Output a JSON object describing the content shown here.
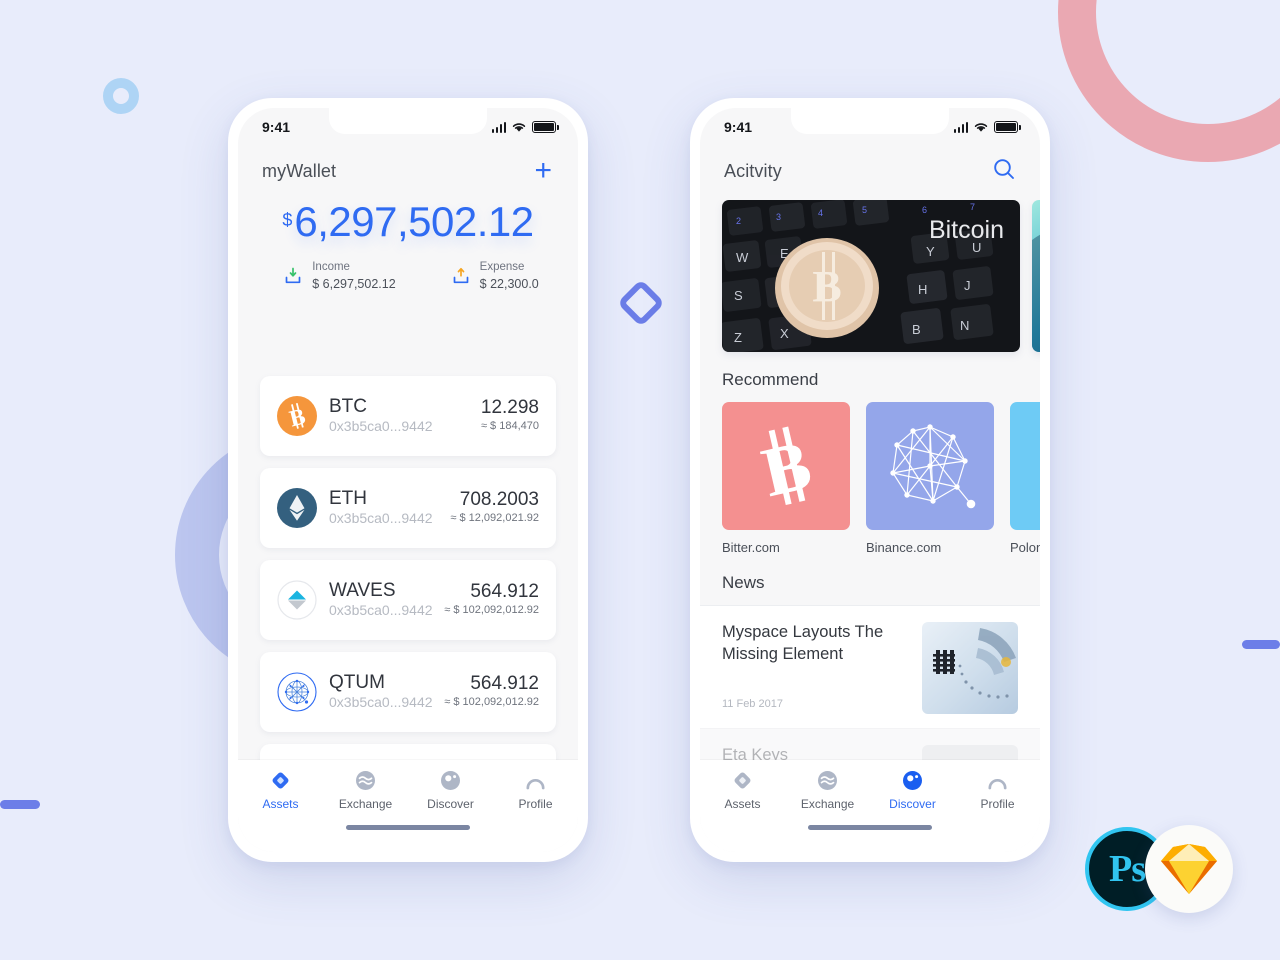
{
  "canvas": {
    "background_color": "#e8ecfb"
  },
  "decorations": {
    "ring_pink_color": "#eaa8b2",
    "ring_blue_small_color": "#aed4f5",
    "ring_periwinkle_color": "#bcc6ef",
    "bar_color": "#6c7ee8",
    "diamond_color": "#6c7ee8"
  },
  "status_bar": {
    "time": "9:41",
    "signal_icon": "cellular-signal-icon",
    "wifi_icon": "wifi-icon",
    "battery_icon": "battery-icon"
  },
  "wallet_screen": {
    "nav": {
      "title": "myWallet",
      "add_label": "+",
      "add_icon": "plus-icon"
    },
    "balance": {
      "currency_symbol": "$",
      "amount": "6,297,502.12",
      "accent_color": "#2f6bf2"
    },
    "summary": [
      {
        "icon": "income-download-icon",
        "label": "Income",
        "value": "$ 6,297,502.12",
        "arrow_color": "#37c16a"
      },
      {
        "icon": "expense-upload-icon",
        "label": "Expense",
        "value": "$ 22,300.0",
        "arrow_color": "#f5a623"
      }
    ],
    "assets": [
      {
        "icon": "bitcoin-icon",
        "symbol": "BTC",
        "address": "0x3b5ca0...9442",
        "quantity": "12.298",
        "usd": "≈ $ 184,470"
      },
      {
        "icon": "ethereum-icon",
        "symbol": "ETH",
        "address": "0x3b5ca0...9442",
        "quantity": "708.2003",
        "usd": "≈ $ 12,092,021.92"
      },
      {
        "icon": "waves-icon",
        "symbol": "WAVES",
        "address": "0x3b5ca0...9442",
        "quantity": "564.912",
        "usd": "≈ $ 102,092,012.92"
      },
      {
        "icon": "qtum-icon",
        "symbol": "QTUM",
        "address": "0x3b5ca0...9442",
        "quantity": "564.912",
        "usd": "≈ $ 102,092,012.92"
      }
    ],
    "tabs": [
      {
        "label": "Assets",
        "icon": "assets-diamond-icon",
        "active": true
      },
      {
        "label": "Exchange",
        "icon": "exchange-waves-icon",
        "active": false
      },
      {
        "label": "Discover",
        "icon": "discover-compass-icon",
        "active": false
      },
      {
        "label": "Profile",
        "icon": "profile-person-icon",
        "active": false
      }
    ]
  },
  "discover_screen": {
    "nav": {
      "title": "Acitvity",
      "search_icon": "search-icon"
    },
    "carousel": [
      {
        "label": "Bitcoin",
        "image": "bitcoin-coin-on-keyboard-photo"
      },
      {
        "label": "",
        "image": "teal-abstract-photo"
      }
    ],
    "recommend": {
      "title": "Recommend",
      "items": [
        {
          "name": "Bitter.com",
          "icon": "bitcoin-b-icon",
          "color": "#f49090"
        },
        {
          "name": "Binance.com",
          "icon": "polygon-mesh-icon",
          "color": "#94a6ea"
        },
        {
          "name": "Poloniex",
          "icon": "poloniex-icon",
          "color": "#6ecbf5"
        }
      ]
    },
    "news": {
      "title": "News",
      "items": [
        {
          "title": "Myspace Layouts The Missing Element",
          "date": "11 Feb 2017",
          "thumb": "ibm-logo-coils-photo"
        },
        {
          "title": "Eta Keys",
          "date": "",
          "thumb": "portrait-photo"
        }
      ]
    },
    "tabs": [
      {
        "label": "Assets",
        "icon": "assets-diamond-icon",
        "active": false
      },
      {
        "label": "Exchange",
        "icon": "exchange-waves-icon",
        "active": false
      },
      {
        "label": "Discover",
        "icon": "discover-compass-icon",
        "active": true
      },
      {
        "label": "Profile",
        "icon": "profile-person-icon",
        "active": false
      }
    ]
  },
  "badges": [
    {
      "name": "photoshop-badge",
      "label": "Ps"
    },
    {
      "name": "sketch-badge",
      "label": ""
    }
  ]
}
